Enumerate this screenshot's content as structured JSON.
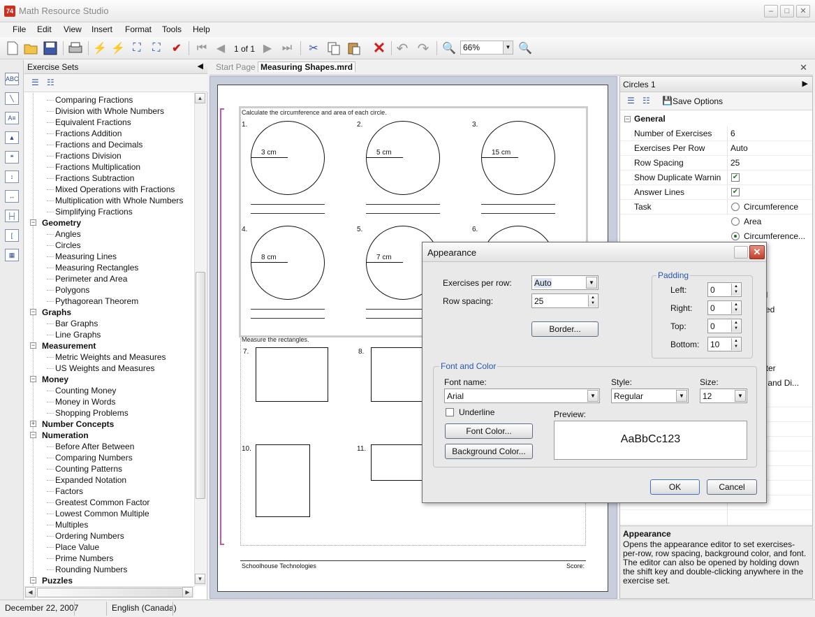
{
  "app": {
    "title": "Math Resource Studio"
  },
  "menu": [
    "File",
    "Edit",
    "View",
    "Insert",
    "Format",
    "Tools",
    "Help"
  ],
  "toolbar": {
    "page_indicator": "1 of 1",
    "zoom": "66%"
  },
  "sets_panel": {
    "title": "Exercise Sets",
    "tree": [
      {
        "label": "Comparing Fractions",
        "level": 1
      },
      {
        "label": "Division with Whole Numbers",
        "level": 1
      },
      {
        "label": "Equivalent Fractions",
        "level": 1
      },
      {
        "label": "Fractions Addition",
        "level": 1
      },
      {
        "label": "Fractions and Decimals",
        "level": 1
      },
      {
        "label": "Fractions Division",
        "level": 1
      },
      {
        "label": "Fractions Multiplication",
        "level": 1
      },
      {
        "label": "Fractions Subtraction",
        "level": 1
      },
      {
        "label": "Mixed Operations with Fractions",
        "level": 1
      },
      {
        "label": "Multiplication with Whole Numbers",
        "level": 1
      },
      {
        "label": "Simplifying Fractions",
        "level": 1
      },
      {
        "label": "Geometry",
        "level": 0,
        "expanded": true
      },
      {
        "label": "Angles",
        "level": 1
      },
      {
        "label": "Circles",
        "level": 1
      },
      {
        "label": "Measuring Lines",
        "level": 1
      },
      {
        "label": "Measuring Rectangles",
        "level": 1
      },
      {
        "label": "Perimeter and Area",
        "level": 1
      },
      {
        "label": "Polygons",
        "level": 1
      },
      {
        "label": "Pythagorean Theorem",
        "level": 1
      },
      {
        "label": "Graphs",
        "level": 0,
        "expanded": true
      },
      {
        "label": "Bar Graphs",
        "level": 1
      },
      {
        "label": "Line Graphs",
        "level": 1
      },
      {
        "label": "Measurement",
        "level": 0,
        "expanded": true
      },
      {
        "label": "Metric Weights and Measures",
        "level": 1
      },
      {
        "label": "US Weights and Measures",
        "level": 1
      },
      {
        "label": "Money",
        "level": 0,
        "expanded": true
      },
      {
        "label": "Counting Money",
        "level": 1
      },
      {
        "label": "Money in Words",
        "level": 1
      },
      {
        "label": "Shopping Problems",
        "level": 1
      },
      {
        "label": "Number Concepts",
        "level": 0,
        "expanded": false
      },
      {
        "label": "Numeration",
        "level": 0,
        "expanded": true
      },
      {
        "label": "Before After Between",
        "level": 1
      },
      {
        "label": "Comparing Numbers",
        "level": 1
      },
      {
        "label": "Counting Patterns",
        "level": 1
      },
      {
        "label": "Expanded Notation",
        "level": 1
      },
      {
        "label": "Factors",
        "level": 1
      },
      {
        "label": "Greatest Common Factor",
        "level": 1
      },
      {
        "label": "Lowest Common Multiple",
        "level": 1
      },
      {
        "label": "Multiples",
        "level": 1
      },
      {
        "label": "Ordering Numbers",
        "level": 1
      },
      {
        "label": "Place Value",
        "level": 1
      },
      {
        "label": "Prime Numbers",
        "level": 1
      },
      {
        "label": "Rounding Numbers",
        "level": 1
      },
      {
        "label": "Puzzles",
        "level": 0,
        "expanded": true
      }
    ]
  },
  "doc_tabs": [
    "Start Page",
    "Measuring Shapes.mrd"
  ],
  "worksheet": {
    "instruction1": "Calculate the circumference and area of each circle.",
    "circles": [
      {
        "num": "1.",
        "label": "3 cm"
      },
      {
        "num": "2.",
        "label": "5 cm"
      },
      {
        "num": "3.",
        "label": "15 cm"
      },
      {
        "num": "4.",
        "label": "8 cm"
      },
      {
        "num": "5.",
        "label": "7 cm"
      },
      {
        "num": "6.",
        "label": ""
      }
    ],
    "instruction2": "Measure the rectangles.",
    "rect_nums": [
      "7.",
      "8.",
      "10.",
      "11."
    ],
    "footer_left": "Schoolhouse Technologies",
    "footer_right": "Score:"
  },
  "props": {
    "title": "Circles 1",
    "save_options": "Save Options",
    "section": "General",
    "rows": [
      {
        "label": "Number of Exercises",
        "value": "6"
      },
      {
        "label": "Exercises Per Row",
        "value": "Auto"
      },
      {
        "label": "Row Spacing",
        "value": "25"
      },
      {
        "label": "Show Duplicate Warnin",
        "value": ""
      },
      {
        "label": "Answer Lines",
        "value": ""
      },
      {
        "label": "Task",
        "value": ""
      }
    ],
    "task_options": [
      "Circumference",
      "Area",
      "Circumference..."
    ],
    "partial_right": [
      "al",
      "ced",
      "s",
      "eter",
      "s and Di..."
    ],
    "help_title": "Appearance",
    "help_text": "Opens the appearance editor to set exercises-per-row, row spacing, background color, and font. The editor can also be opened by holding down the shift key and double-clicking anywhere in the exercise set."
  },
  "status": {
    "date": "December 22, 2007",
    "language": "English (Canada)"
  },
  "dialog": {
    "title": "Appearance",
    "exercises_per_row_label": "Exercises per row:",
    "exercises_per_row_value": "Auto",
    "row_spacing_label": "Row spacing:",
    "row_spacing_value": "25",
    "border_button": "Border...",
    "padding_legend": "Padding",
    "padding": [
      {
        "label": "Left:",
        "value": "0"
      },
      {
        "label": "Right:",
        "value": "0"
      },
      {
        "label": "Top:",
        "value": "0"
      },
      {
        "label": "Bottom:",
        "value": "10"
      }
    ],
    "font_legend": "Font and Color",
    "font_name_label": "Font name:",
    "font_name_value": "Arial",
    "style_label": "Style:",
    "style_value": "Regular",
    "size_label": "Size:",
    "size_value": "12",
    "underline_label": "Underline",
    "font_color_button": "Font Color...",
    "background_color_button": "Background Color...",
    "preview_label": "Preview:",
    "preview_text": "AaBbCc123",
    "ok_button": "OK",
    "cancel_button": "Cancel"
  }
}
